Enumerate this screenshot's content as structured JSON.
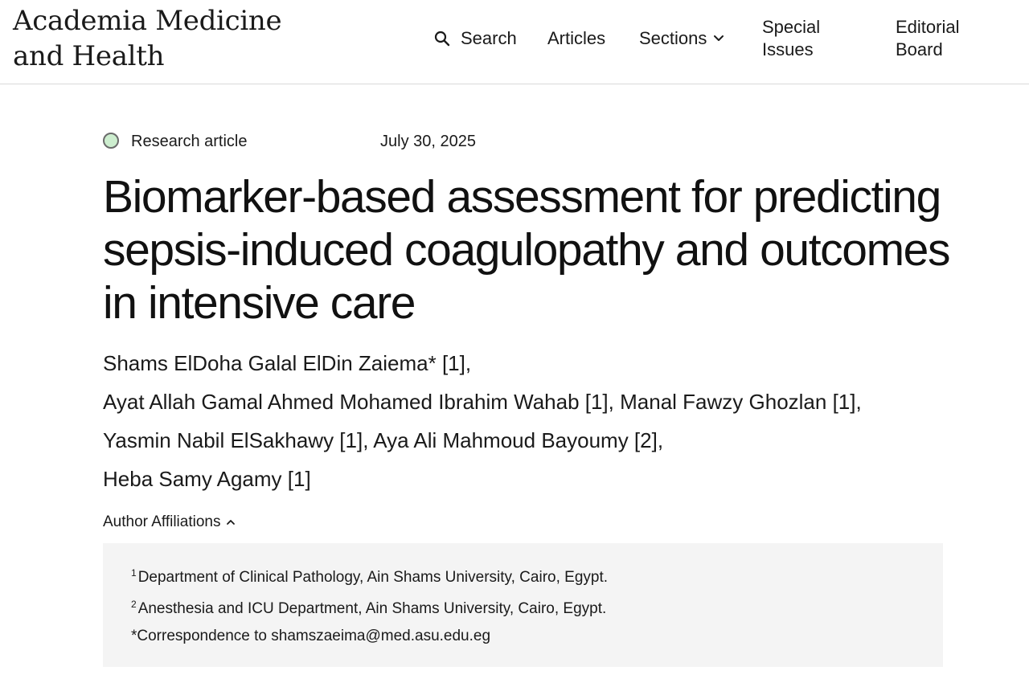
{
  "header": {
    "site_title": "Academia Medicine and Health",
    "nav": {
      "search": "Search",
      "articles": "Articles",
      "sections": "Sections",
      "special_issues": "Special Issues",
      "editorial_board": "Editorial Board"
    }
  },
  "article": {
    "type": "Research article",
    "type_dot_color": "#cdeecf",
    "date": "July 30, 2025",
    "title": "Biomarker-based assessment for predicting sepsis-induced coagulopathy and outcomes in intensive care",
    "authors": [
      "Shams ElDoha Galal ElDin Zaiema* [1],",
      "Ayat Allah Gamal Ahmed Mohamed Ibrahim Wahab [1],",
      "Manal Fawzy Ghozlan [1],",
      "Yasmin Nabil ElSakhawy [1],",
      "Aya Ali Mahmoud Bayoumy [2],",
      "Heba Samy Agamy [1]"
    ],
    "affiliations_toggle": "Author Affiliations",
    "affiliations": [
      {
        "num": "1",
        "text": "Department of Clinical Pathology, Ain Shams University, Cairo, Egypt."
      },
      {
        "num": "2",
        "text": "Anesthesia and ICU Department, Ain Shams University, Cairo, Egypt."
      }
    ],
    "correspondence": "*Correspondence to shamszaeima@med.asu.edu.eg"
  },
  "icons": {
    "search": "search-icon",
    "sections": "chevron-down-icon",
    "affiliations": "chevron-up-icon"
  }
}
